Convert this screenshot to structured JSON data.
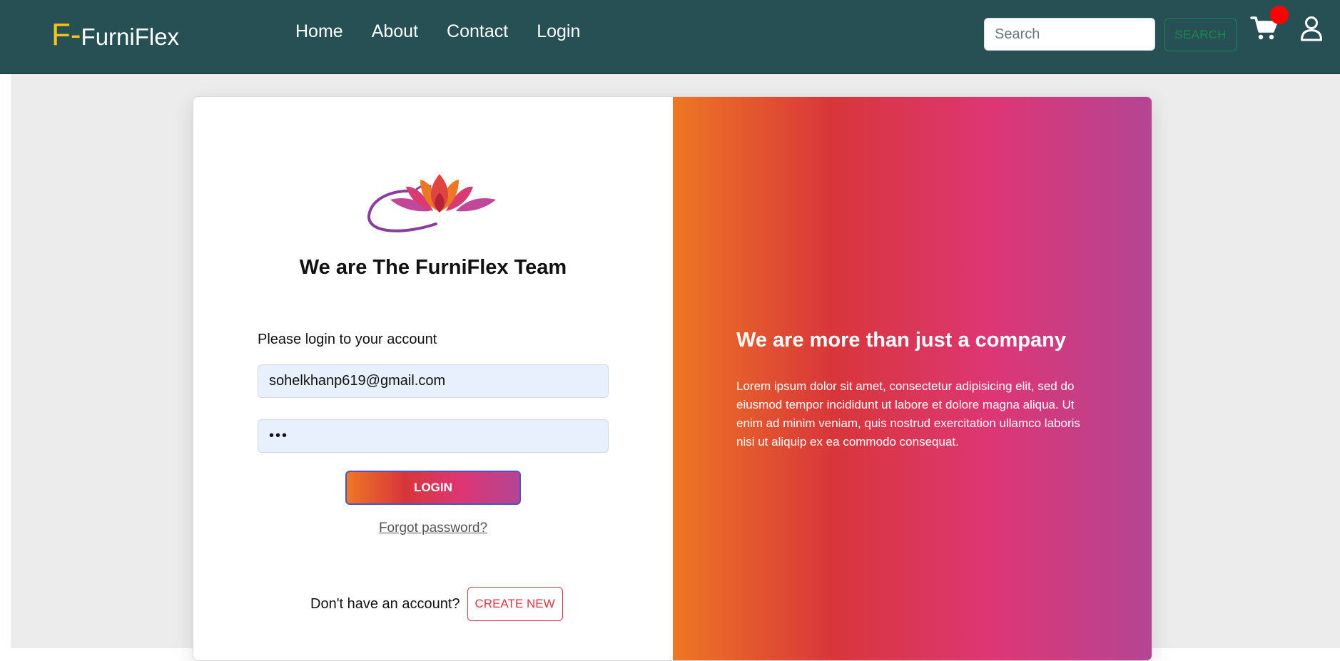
{
  "navbar": {
    "brand_prefix": "F-",
    "brand_name": "FurniFlex",
    "links": [
      "Home",
      "About",
      "Contact",
      "Login"
    ],
    "search_placeholder": "Search",
    "search_button": "SEARCH",
    "icons": {
      "cart": "cart-icon",
      "user": "user-icon"
    },
    "colors": {
      "background": "#275055",
      "brand_accent": "#f5c518",
      "search_button": "#198754",
      "badge": "#ff0000"
    }
  },
  "login_panel": {
    "logo": "lotus-logo",
    "title": "We are The FurniFlex Team",
    "prompt": "Please login to your account",
    "email_value": "sohelkhanp619@gmail.com",
    "password_value": "•••",
    "login_button": "LOGIN",
    "forgot_link": "Forgot password?",
    "signup_text": "Don't have an account?",
    "create_button": "CREATE NEW"
  },
  "info_panel": {
    "title": "We are more than just a company",
    "body": "Lorem ipsum dolor sit amet, consectetur adipisicing elit, sed do eiusmod tempor incididunt ut labore et dolore magna aliqua. Ut enim ad minim veniam, quis nostrud exercitation ullamco laboris nisi ut aliquip ex ea commodo consequat.",
    "gradient": [
      "#ee7724",
      "#d8363a",
      "#dd3675",
      "#b44593"
    ]
  }
}
